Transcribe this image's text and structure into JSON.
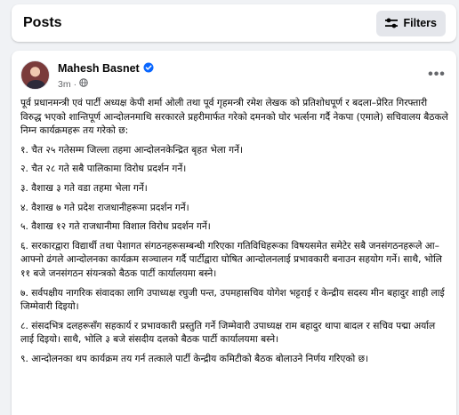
{
  "posts_header": {
    "title": "Posts",
    "filters_label": "Filters"
  },
  "post": {
    "author": "Mahesh Basnet",
    "time": "3m",
    "separator": "·",
    "more_label": "•••",
    "intro": "पूर्व प्रधानमन्त्री  एवं पार्टी अध्यक्ष केपी शर्मा ओली तथा पूर्व गृहमन्त्री रमेश लेखक को प्रतिशोधपूर्ण र बदला–प्रेरित गिरफ्तारी विरुद्ध भएको शान्तिपूर्ण आन्दोलनमाथि सरकारले प्रहरीमार्फत गरेको दमनको घोर भर्त्सना गर्दै नेकपा (एमाले) सचिवालय बैठकले निम्न कार्यक्रमहरू तय गरेको छ:",
    "items": [
      "१. चैत २५ गतेसम्म जिल्ला तहमा आन्दोलनकेन्द्रित बृहत भेला गर्ने।",
      "२. चैत २८ गते सबै पालिकामा विरोध प्रदर्शन गर्ने।",
      "३. वैशाख ३ गते वडा तहमा भेला गर्ने।",
      "४. वैशाख ७ गते प्रदेश राजधानीहरूमा प्रदर्शन गर्ने।",
      "५. वैशाख १२ गते राजधानीमा विशाल विरोध प्रदर्शन गर्ने।",
      "६. सरकारद्वारा विद्यार्थी तथा पेशागत संगठनहरूसम्बन्धी गरिएका गतिविधिहरूका विषयसमेत समेटेर सबै जनसंगठनहरूले आ–आफ्नो ढंगले आन्दोलनका कार्यक्रम सञ्चालन गर्दै पार्टीद्वारा घोषित आन्दोलनलाई प्रभावकारी बनाउन सहयोग गर्ने। साथै, भोलि ११ बजे जनसंगठन संयन्त्रको बैठक पार्टी कार्यालयमा बस्ने।",
      "७. सर्वपक्षीय नागरिक संवादका लागि उपाध्यक्ष रघुजी पन्त, उपमहासचिव योगेश भट्टराई र केन्द्रीय सदस्य मीन बहादुर शाही लाई जिम्मेवारी दिइयो।",
      "८. संसदभित्र दलहरूसँग सहकार्य र प्रभावकारी प्रस्तुति गर्ने जिम्मेवारी उपाध्यक्ष राम बहादुर थापा बादल र सचिव पद्मा अर्याल लाई दिइयो। साथै, भोलि ३ बजे संसदीय दलको बैठक पार्टी कार्यालयमा बस्ने।",
      "९. आन्दोलनका थप कार्यक्रम तय गर्न तत्काले पार्टी केन्द्रीय कमिटीको बैठक बोलाउने निर्णय गरिएको छ।"
    ]
  },
  "colors": {
    "background": "#f0f2f5",
    "card": "#ffffff",
    "verified_badge": "#0866ff",
    "secondary_text": "#65676b",
    "button_bg": "#e4e6eb"
  },
  "icons": {
    "filters": "sliders-icon",
    "verified": "verified-badge-icon",
    "privacy": "globe-icon",
    "more": "more-horizontal-icon"
  }
}
